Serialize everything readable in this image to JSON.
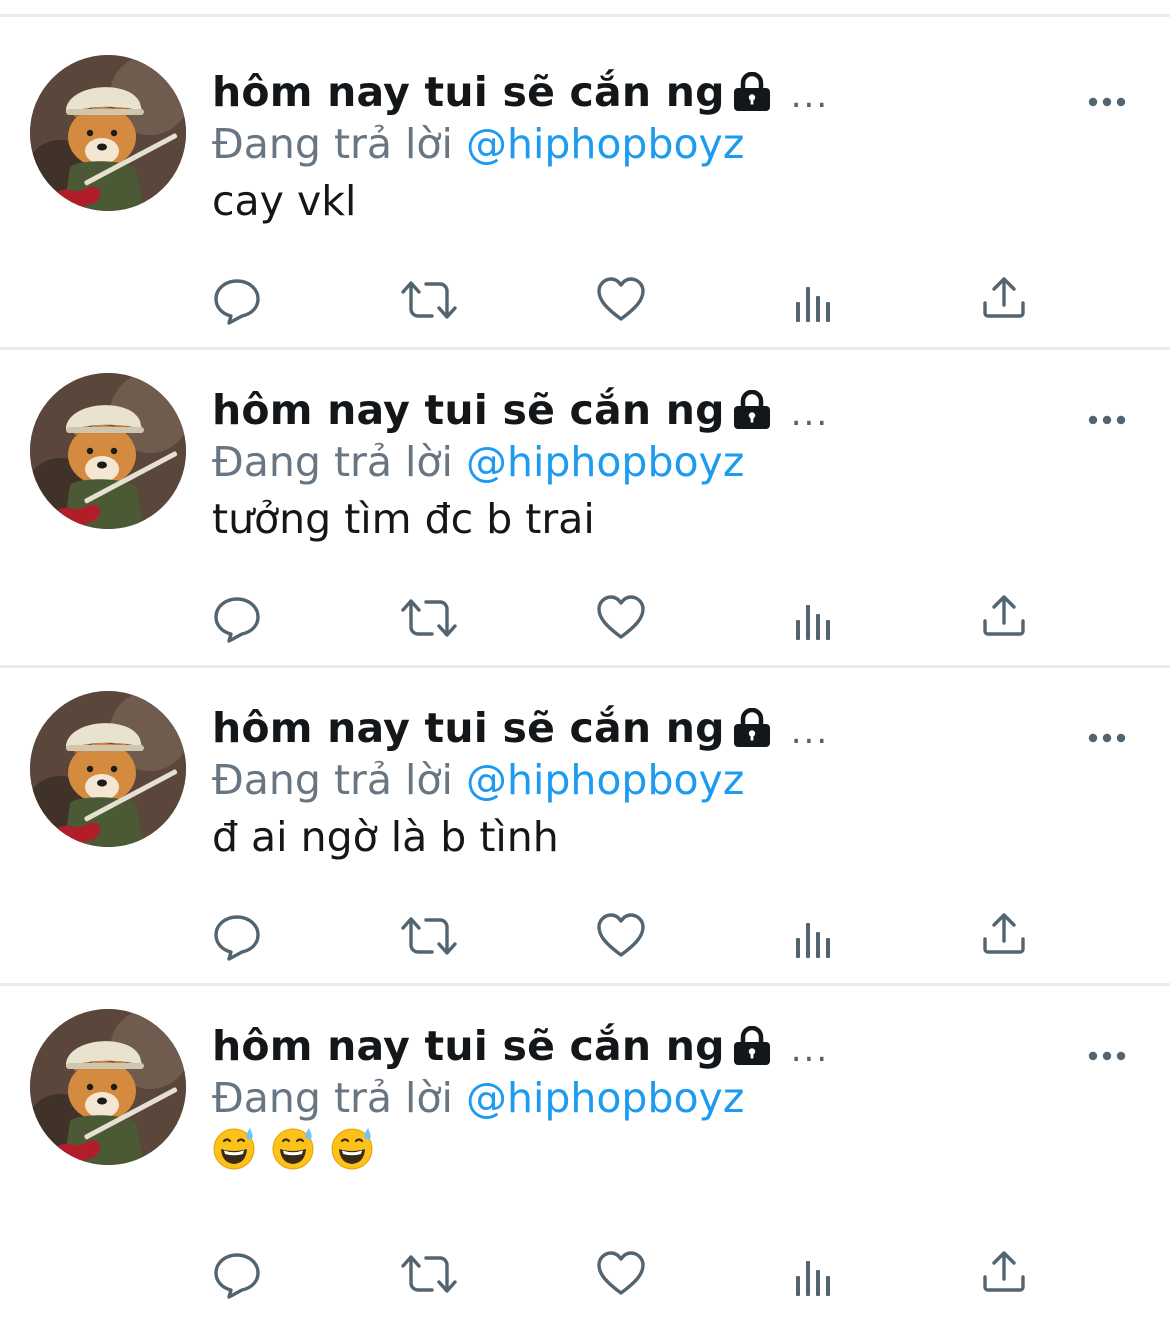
{
  "colors": {
    "text": "#14171a",
    "secondary": "#687684",
    "accent": "#1d9bf0",
    "icon": "#536471",
    "divider": "#e6ecf0"
  },
  "tweets": [
    {
      "name": "hôm nay tui sẽ cắn ng",
      "lock_icon": "lock-icon",
      "more_label": "...",
      "reply_label": "Đang trả lời",
      "reply_handle": "@hiphopboyz",
      "text": "cay vkl"
    },
    {
      "name": "hôm nay tui sẽ cắn ng",
      "lock_icon": "lock-icon",
      "more_label": "...",
      "reply_label": "Đang trả lời",
      "reply_handle": "@hiphopboyz",
      "text": "tưởng tìm đc b trai"
    },
    {
      "name": "hôm nay tui sẽ cắn ng",
      "lock_icon": "lock-icon",
      "more_label": "...",
      "reply_label": "Đang trả lời",
      "reply_handle": "@hiphopboyz",
      "text": "đ ai ngờ là b tình"
    },
    {
      "name": "hôm nay tui sẽ cắn ng",
      "lock_icon": "lock-icon",
      "more_label": "...",
      "reply_label": "Đang trả lời",
      "reply_handle": "@hiphopboyz",
      "text": "",
      "emojis": [
        "grinning-sweat-emoji",
        "grinning-sweat-emoji",
        "grinning-sweat-emoji"
      ]
    }
  ],
  "action_icons": [
    "reply-icon",
    "retweet-icon",
    "like-icon",
    "analytics-icon",
    "share-icon"
  ]
}
